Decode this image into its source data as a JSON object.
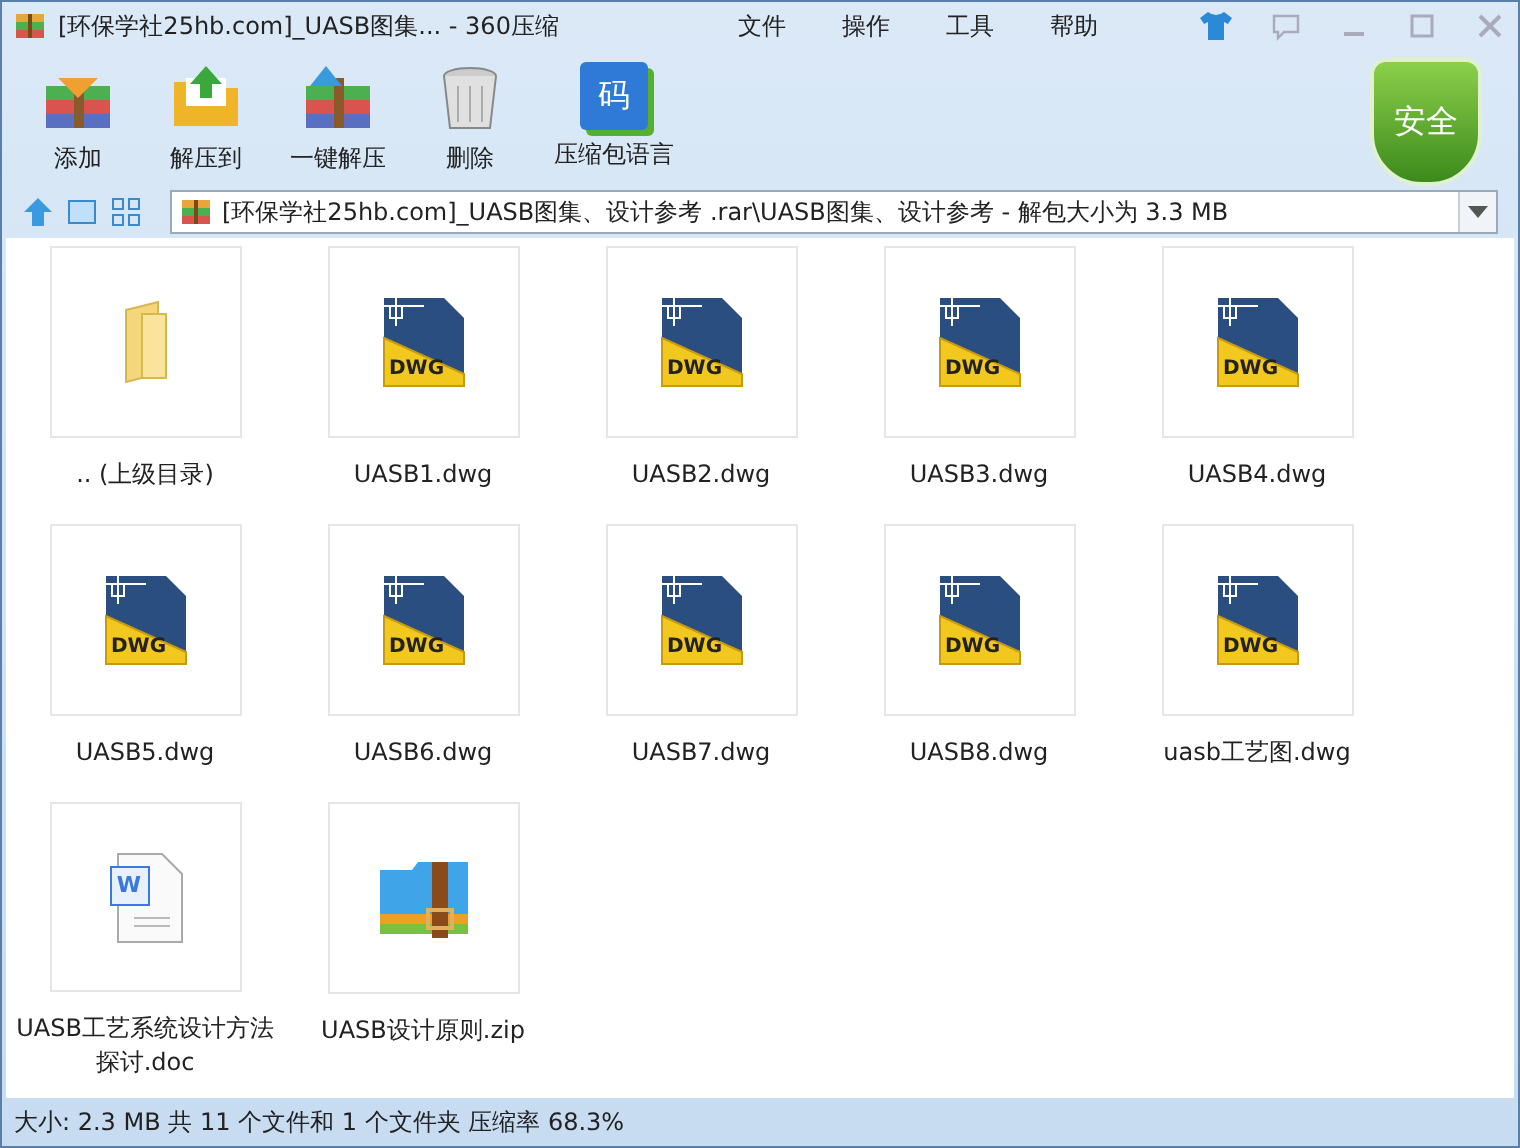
{
  "window": {
    "title": "[环保学社25hb.com]_UASB图集... - 360压缩"
  },
  "menu": [
    "文件",
    "操作",
    "工具",
    "帮助"
  ],
  "toolbar": [
    {
      "label": "添加",
      "kind": "add"
    },
    {
      "label": "解压到",
      "kind": "extract"
    },
    {
      "label": "一键解压",
      "kind": "quick"
    },
    {
      "label": "删除",
      "kind": "delete"
    },
    {
      "label": "压缩包语言",
      "kind": "language",
      "glyph": "码"
    }
  ],
  "security_badge": "安全",
  "address_bar": {
    "value": "[环保学社25hb.com]_UASB图集、设计参考 .rar\\UASB图集、设计参考 - 解包大小为 3.3 MB"
  },
  "files": [
    {
      "name": ".. (上级目录)",
      "kind": "folder"
    },
    {
      "name": "UASB1.dwg",
      "kind": "dwg",
      "badge": "DWG"
    },
    {
      "name": "UASB2.dwg",
      "kind": "dwg",
      "badge": "DWG"
    },
    {
      "name": "UASB3.dwg",
      "kind": "dwg",
      "badge": "DWG"
    },
    {
      "name": "UASB4.dwg",
      "kind": "dwg",
      "badge": "DWG"
    },
    {
      "name": "UASB5.dwg",
      "kind": "dwg",
      "badge": "DWG"
    },
    {
      "name": "UASB6.dwg",
      "kind": "dwg",
      "badge": "DWG"
    },
    {
      "name": "UASB7.dwg",
      "kind": "dwg",
      "badge": "DWG"
    },
    {
      "name": "UASB8.dwg",
      "kind": "dwg",
      "badge": "DWG"
    },
    {
      "name": "uasb工艺图.dwg",
      "kind": "dwg",
      "badge": "DWG"
    },
    {
      "name": "UASB工艺系统设计方法探讨.doc",
      "kind": "doc",
      "badge": "W"
    },
    {
      "name": "UASB设计原则.zip",
      "kind": "zip"
    }
  ],
  "status_bar": "大小: 2.3 MB 共 11 个文件和 1 个文件夹 压缩率 68.3%"
}
